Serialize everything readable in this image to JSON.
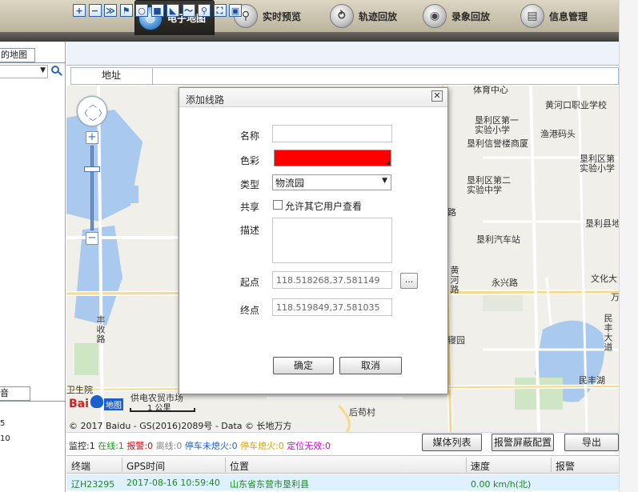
{
  "nav": {
    "tabs": [
      {
        "label": "电子地图",
        "icon": "globe-icon"
      },
      {
        "label": "实时预览",
        "icon": "search-icon"
      },
      {
        "label": "轨迹回放",
        "icon": "track-icon"
      },
      {
        "label": "录象回放",
        "icon": "camera-icon"
      },
      {
        "label": "信息管理",
        "icon": "info-icon"
      }
    ]
  },
  "left_panel": {
    "tab_label": "的地图",
    "tab2_label": "音",
    "row_digit_1": "5",
    "row_digit_2": "10"
  },
  "map_toolbar": {
    "tools": [
      "zoom-in-icon",
      "zoom-out-icon",
      "pan-icon",
      "flag-icon",
      "circle-icon",
      "rectangle-icon",
      "polygon-icon",
      "polyline-icon",
      "search-icon",
      "fullscreen-icon",
      "save-icon"
    ],
    "tool_glyphs": [
      "+",
      "−",
      "≫",
      "⚑",
      "○",
      "■",
      "◣",
      "〜",
      "⚲",
      "⛶",
      "▣"
    ]
  },
  "address": {
    "label": "地址"
  },
  "map": {
    "labels": [
      "体育中心",
      "黄河口职业学校",
      "垦利区第一",
      "实验小学",
      "渔港码头",
      "垦利信誉楼商厦",
      "垦利区第二",
      "实验中学",
      "垦利区第",
      "实验小学",
      "垦利县地",
      "垦利汽车站",
      "永兴路",
      "文化大",
      "万",
      "民丰大道",
      "民丰湖",
      "后苟村",
      "供电农贸市场",
      "丰收路",
      "寝园",
      "黄河路",
      "路",
      "卫生院"
    ],
    "scale_label": "1 公里",
    "copyright": "© 2017 Baidu - GS(2016)2089号 - Data © 长地万方",
    "logo_text_bai": "Bai",
    "logo_text_ditu": "地图"
  },
  "dialog": {
    "title": "添加线路",
    "close_glyph": "✕",
    "labels": {
      "name": "名称",
      "color": "色彩",
      "type": "类型",
      "share": "共享",
      "desc": "描述",
      "start": "起点",
      "end": "终点"
    },
    "name_value": "",
    "color_value": "#ff0000",
    "type_selected": "物流园",
    "share_text": "允许其它用户查看",
    "share_checked": false,
    "desc_value": "",
    "start_value": "118.518268,37.581149",
    "end_value": "118.519849,37.581035",
    "ellipsis_label": "...",
    "confirm_label": "确定",
    "cancel_label": "取消"
  },
  "status": {
    "monitor": "监控:1",
    "online": "在线:1",
    "alarm": "报警:0",
    "offline": "离线:0",
    "stopped_engine_on": "停车未熄火:0",
    "stopped_engine_off": "停车熄火:0",
    "pos_invalid": "定位无效:0",
    "buttons": {
      "media_list": "媒体列表",
      "alarm_mask": "报警屏蔽配置",
      "export": "导出"
    },
    "colors": {
      "online": "#1a9a1a",
      "alarm": "#e00000",
      "offline": "#888888",
      "stopped_engine_on": "#1a5fd0",
      "stopped_engine_off": "#e0a000",
      "pos_invalid": "#d000d0"
    }
  },
  "grid": {
    "columns": [
      "终端",
      "GPS时间",
      "位置",
      "速度",
      "报警"
    ],
    "rows": [
      {
        "terminal": "辽H23295",
        "gps_time": "2017-08-16 10:59:40",
        "location": "山东省东营市垦利县",
        "speed": "0.00 km/h(北)",
        "alarm": ""
      }
    ]
  }
}
